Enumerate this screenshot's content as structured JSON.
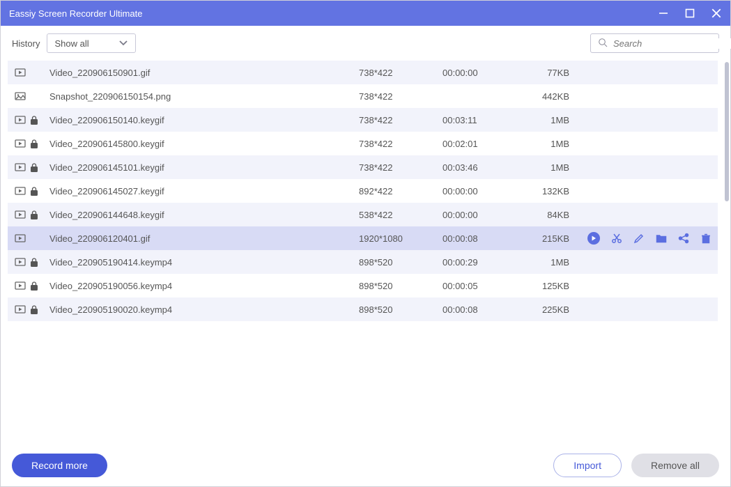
{
  "window": {
    "title": "Eassiy Screen Recorder Ultimate"
  },
  "toolbar": {
    "history_label": "History",
    "filter_selected": "Show all",
    "search_placeholder": "Search"
  },
  "rows": [
    {
      "type": "video",
      "locked": false,
      "name": "Video_220906150901.gif",
      "dim": "738*422",
      "dur": "00:00:00",
      "size": "77KB",
      "selected": false
    },
    {
      "type": "image",
      "locked": false,
      "name": "Snapshot_220906150154.png",
      "dim": "738*422",
      "dur": "",
      "size": "442KB",
      "selected": false
    },
    {
      "type": "video",
      "locked": true,
      "name": "Video_220906150140.keygif",
      "dim": "738*422",
      "dur": "00:03:11",
      "size": "1MB",
      "selected": false
    },
    {
      "type": "video",
      "locked": true,
      "name": "Video_220906145800.keygif",
      "dim": "738*422",
      "dur": "00:02:01",
      "size": "1MB",
      "selected": false
    },
    {
      "type": "video",
      "locked": true,
      "name": "Video_220906145101.keygif",
      "dim": "738*422",
      "dur": "00:03:46",
      "size": "1MB",
      "selected": false
    },
    {
      "type": "video",
      "locked": true,
      "name": "Video_220906145027.keygif",
      "dim": "892*422",
      "dur": "00:00:00",
      "size": "132KB",
      "selected": false
    },
    {
      "type": "video",
      "locked": true,
      "name": "Video_220906144648.keygif",
      "dim": "538*422",
      "dur": "00:00:00",
      "size": "84KB",
      "selected": false
    },
    {
      "type": "video",
      "locked": false,
      "name": "Video_220906120401.gif",
      "dim": "1920*1080",
      "dur": "00:00:08",
      "size": "215KB",
      "selected": true
    },
    {
      "type": "video",
      "locked": true,
      "name": "Video_220905190414.keymp4",
      "dim": "898*520",
      "dur": "00:00:29",
      "size": "1MB",
      "selected": false
    },
    {
      "type": "video",
      "locked": true,
      "name": "Video_220905190056.keymp4",
      "dim": "898*520",
      "dur": "00:00:05",
      "size": "125KB",
      "selected": false
    },
    {
      "type": "video",
      "locked": true,
      "name": "Video_220905190020.keymp4",
      "dim": "898*520",
      "dur": "00:00:08",
      "size": "225KB",
      "selected": false
    }
  ],
  "footer": {
    "record_more": "Record more",
    "import": "Import",
    "remove_all": "Remove all"
  }
}
